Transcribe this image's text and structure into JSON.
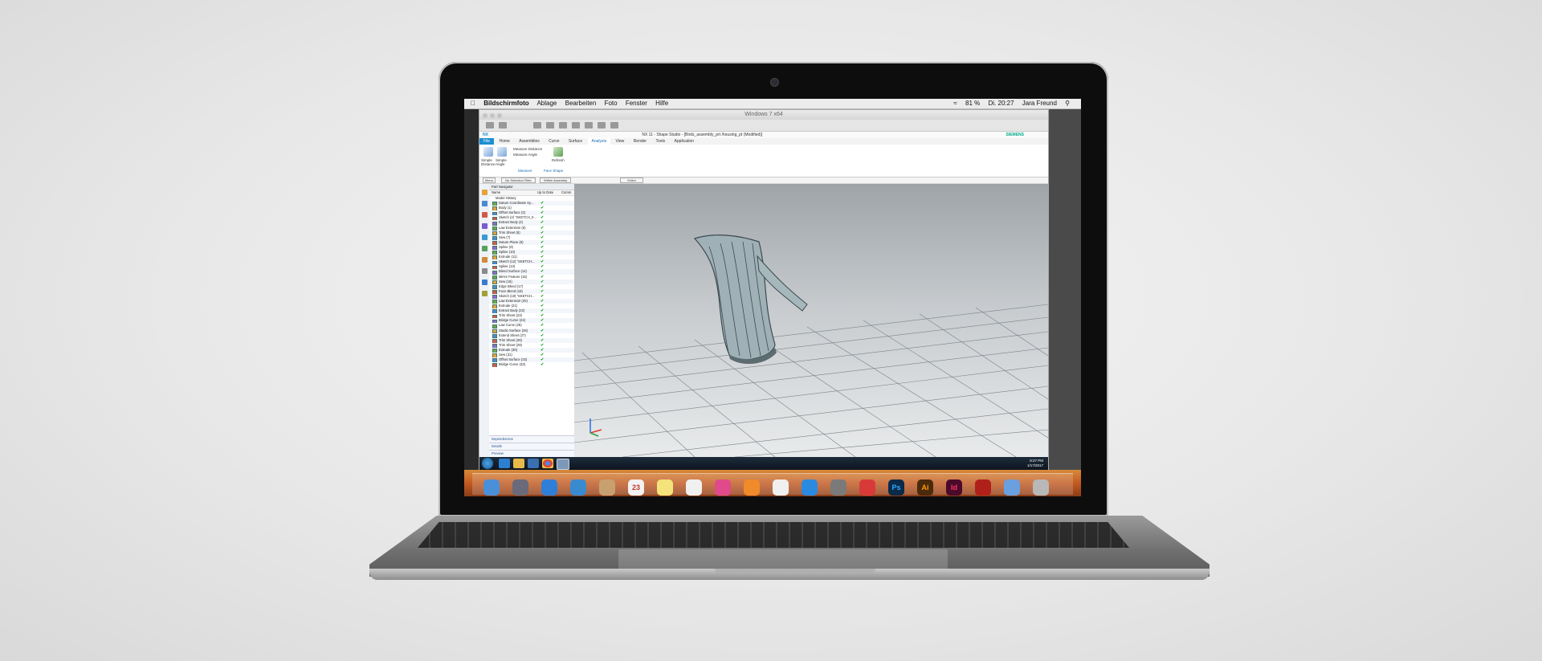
{
  "mac_menubar": {
    "app": "Bildschirmfoto",
    "items": [
      "Ablage",
      "Bearbeiten",
      "Foto",
      "Fenster",
      "Hilfe"
    ],
    "battery": "81 %",
    "clock": "Di. 20:27",
    "user": "Jara Freund"
  },
  "vm_window": {
    "title": "Windows 7 x64"
  },
  "nx": {
    "title": "NX 11 - Shape Studio - [Birds_assembly_prt /housing_pt (Modified)]",
    "brand": "SIEMENS",
    "tabs": [
      "File",
      "Home",
      "Assemblies",
      "Curve",
      "Surface",
      "Analysis",
      "View",
      "Render",
      "Tools",
      "Application"
    ],
    "active_tab": "Analysis",
    "ribbon": {
      "measure_distance": "Measure Distance",
      "measure_angle": "Measure Angle",
      "simple_distance": "Simple Distance",
      "simple_angle": "Simple Angle",
      "refresh": "Refresh",
      "group_measure": "Measure",
      "group_face_shape": "Face Shape"
    },
    "selection_bar": {
      "menu": "Menu",
      "filter": "No Selection Filter",
      "scope": "Within Assembly",
      "snap": "Entire"
    }
  },
  "navigator": {
    "title": "Part Navigator",
    "col_name": "Name",
    "col_uptodate": "Up to Date",
    "col_comment": "Comm",
    "root": "Model History",
    "rows": [
      "Datum Coordinate Sy...",
      "Body (1)",
      "Offset Surface (3)",
      "Sketch (2) \"SKETCH_0...",
      "Extract Body (4)",
      "Law Extension (5)",
      "Trim Sheet (6)",
      "Sew (7)",
      "Datum Plane (8)",
      "Spline (9)",
      "Spline (10)",
      "Extrude (11)",
      "Sketch (12) \"SKETCH...",
      "Spline (13)",
      "Blend Surface (14)",
      "Mirror Feature (15)",
      "Sew (16)",
      "Edge Blend (17)",
      "Face Blend (18)",
      "Sketch (19) \"SKETCH...",
      "Law Extension (20)",
      "Extrude (21)",
      "Extract Body (22)",
      "Trim Sheet (23)",
      "Bridge Curve (24)",
      "Law Curve (25)",
      "Studio Surface (26)",
      "Extend Sheet (27)",
      "Trim Sheet (28)",
      "Trim Sheet (29)",
      "Extrude (30)",
      "Sew (31)",
      "Offset Surface (32)",
      "Bridge Curve (33)"
    ],
    "panels": [
      "Dependencies",
      "Details",
      "Preview"
    ]
  },
  "taskbar": {
    "time": "8:27 PM",
    "date": "1/17/2017"
  },
  "dock_icons": [
    "finder-icon",
    "launchpad-icon",
    "safari-icon",
    "mail-icon",
    "contacts-icon",
    "calendar-icon",
    "notes-icon",
    "photos-icon",
    "itunes-icon",
    "ibooks-icon",
    "keynote-icon",
    "appstore-icon",
    "settings-icon",
    "parallels-icon",
    "photoshop-icon",
    "illustrator-icon",
    "indesign-icon",
    "acrobat-icon",
    "preview-icon",
    "trash-icon"
  ],
  "dock_labels": {
    "calendar": "23",
    "ps": "Ps",
    "ai": "Ai",
    "id": "Id"
  }
}
